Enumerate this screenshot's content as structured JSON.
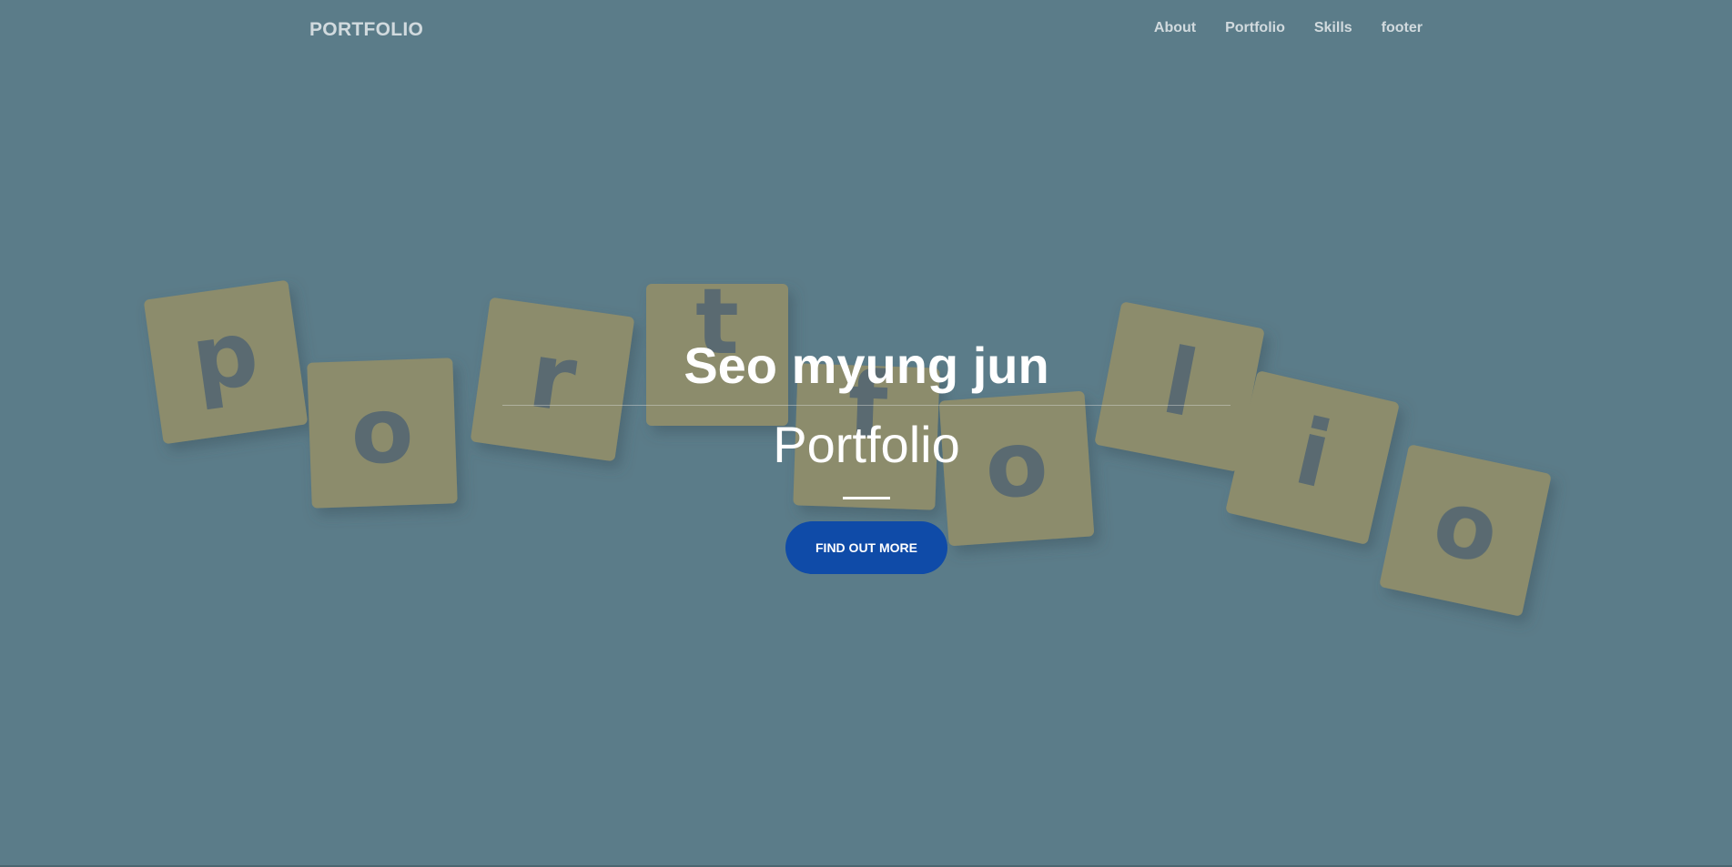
{
  "nav": {
    "brand": "PORTFOLIO",
    "links": [
      {
        "label": "About"
      },
      {
        "label": "Portfolio"
      },
      {
        "label": "Skills"
      },
      {
        "label": "footer"
      }
    ]
  },
  "hero": {
    "title": "Seo myung jun",
    "subtitle": "Portfolio",
    "cta_label": "FIND OUT MORE"
  },
  "colors": {
    "background": "#5f7f8b",
    "tile": "#9a9368",
    "cta": "#0f4ba8"
  }
}
